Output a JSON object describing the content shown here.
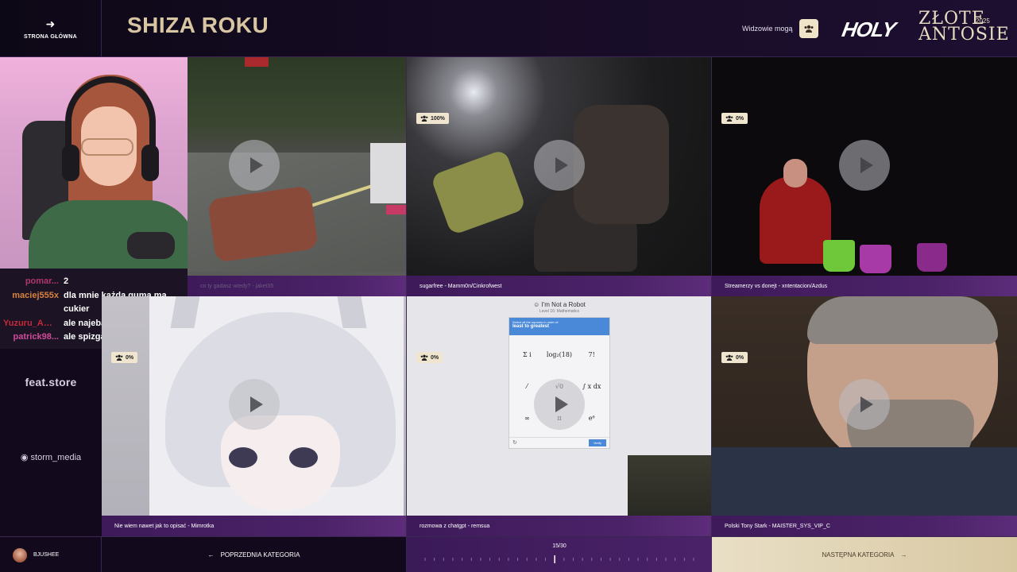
{
  "header": {
    "back_label": "STRONA GŁÓWNA",
    "title": "SHIZA ROKU",
    "viewers_label": "Widzowie mogą",
    "logo_holy": "HOLY",
    "logo_line1": "ZŁOTE",
    "logo_line2": "ANTOSIE",
    "logo_year": "2025"
  },
  "chat": [
    {
      "user": "pomar...",
      "msg": "2",
      "color": "#b0356f"
    },
    {
      "user": "maciej555x",
      "msg": "dla mnie każda guma ma cukier",
      "color": "#d8823e"
    },
    {
      "user": "Yuzuru_Ama...",
      "msg": "ale najebani XD",
      "color": "#c8283a"
    },
    {
      "user": "patrick98...",
      "msg": "ale spizgani są",
      "color": "#d04a9a"
    }
  ],
  "sponsors": {
    "feat": "feat.store",
    "storm": "storm_media"
  },
  "tiles": [
    {
      "caption": "co ty gadasz wtedy? - jaket35",
      "percent": ""
    },
    {
      "caption": "sugarfree - Mamm0n/Cinkrofwest",
      "percent": "100%"
    },
    {
      "caption": "Streamerzy vs donejt - xntentacion/Azdus",
      "percent": "0%"
    },
    {
      "caption": "Nie wiem nawet jak to opisać - Mimrotka",
      "percent": "0%"
    },
    {
      "caption": "rozmowa z chatgpt - remsua",
      "percent": "0%"
    },
    {
      "caption": "Polski Tony Stark - MAISTER_SYS_VIP_C",
      "percent": "0%"
    }
  ],
  "captcha": {
    "title": "I'm Not a Robot",
    "subtitle": "Level 16: Mathematics",
    "instruction_small": "Select all the squares in order of:",
    "instruction": "least to greatest",
    "cells": [
      "Σ i",
      "log₂(18)",
      "7!",
      "⁄",
      "√0",
      "∫ x dx",
      "∞",
      "π",
      "eᶿ"
    ],
    "verify": "Verify"
  },
  "footer": {
    "user_name": "BJUSHEE",
    "prev_label": "POPRZEDNIA KATEGORIA",
    "progress_text": "15/30",
    "progress_current": 15,
    "progress_total": 30,
    "next_label": "NASTĘPNA KATEGORIA"
  },
  "colors": {
    "accent_gold": "#d8c6a2",
    "caption_purple": "#4b2268",
    "next_button": "#e9dfc6"
  }
}
